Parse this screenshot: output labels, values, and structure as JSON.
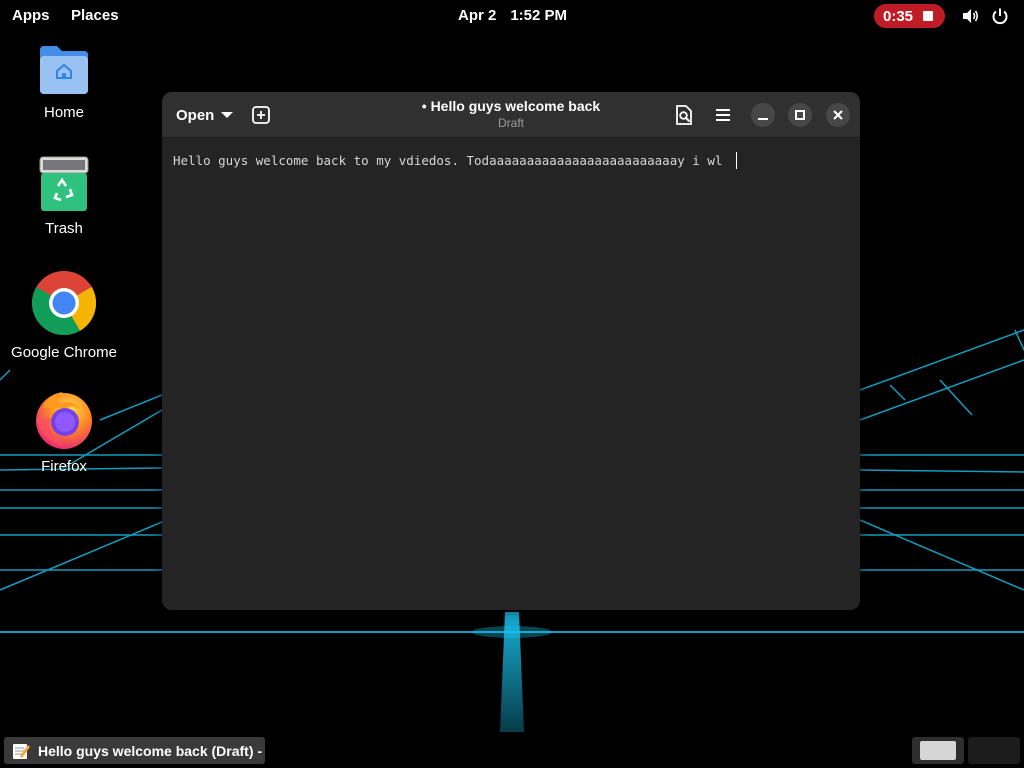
{
  "topbar": {
    "apps_label": "Apps",
    "places_label": "Places",
    "date": "Apr 2",
    "time": "1:52 PM",
    "recording_time": "0:35",
    "recording_color": "#c01c28",
    "volume_icon": "volume-icon",
    "power_icon": "power-icon"
  },
  "desktop": {
    "icons": [
      {
        "label": "Home",
        "icon": "home-folder-icon"
      },
      {
        "label": "Trash",
        "icon": "trash-icon"
      },
      {
        "label": "Google Chrome",
        "icon": "chrome-icon"
      },
      {
        "label": "Firefox",
        "icon": "firefox-icon"
      }
    ]
  },
  "window": {
    "open_label": "Open",
    "title": "• Hello guys welcome back",
    "subtitle": "Draft",
    "editor_text": "Hello guys welcome back to my vdiedos. Todaaaaaaaaaaaaaaaaaaaaaaaaay i wl "
  },
  "taskbar": {
    "task_label": "Hello guys welcome back (Draft) - ..."
  },
  "colors": {
    "accent_neon": "#19c4f0",
    "window_bg": "#242424",
    "headerbar_bg": "#303030"
  }
}
